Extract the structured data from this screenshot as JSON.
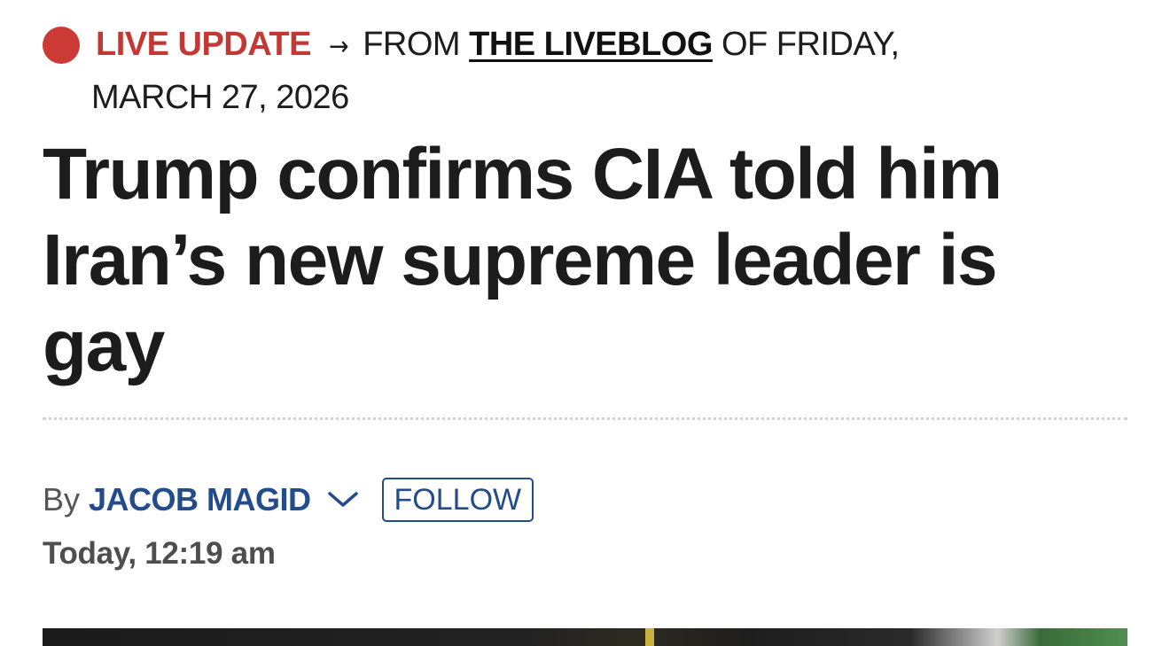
{
  "live_banner": {
    "label": "LIVE UPDATE",
    "arrow": "→",
    "from_text": "FROM",
    "liveblog_link": "THE LIVEBLOG",
    "of_text": "OF FRIDAY,",
    "date": "MARCH 27, 2026"
  },
  "article": {
    "headline": "Trump confirms CIA told him Iran’s new supreme leader is gay"
  },
  "byline": {
    "prefix": "By",
    "author": "JACOB MAGID",
    "follow_label": "FOLLOW",
    "timestamp": "Today, 12:19 am"
  },
  "colors": {
    "live_red": "#c33834",
    "author_blue": "#234c8c",
    "headline": "#1c1c1c"
  },
  "icons": {
    "live_dot": "live-dot-icon",
    "expand": "chevron-down-icon"
  }
}
